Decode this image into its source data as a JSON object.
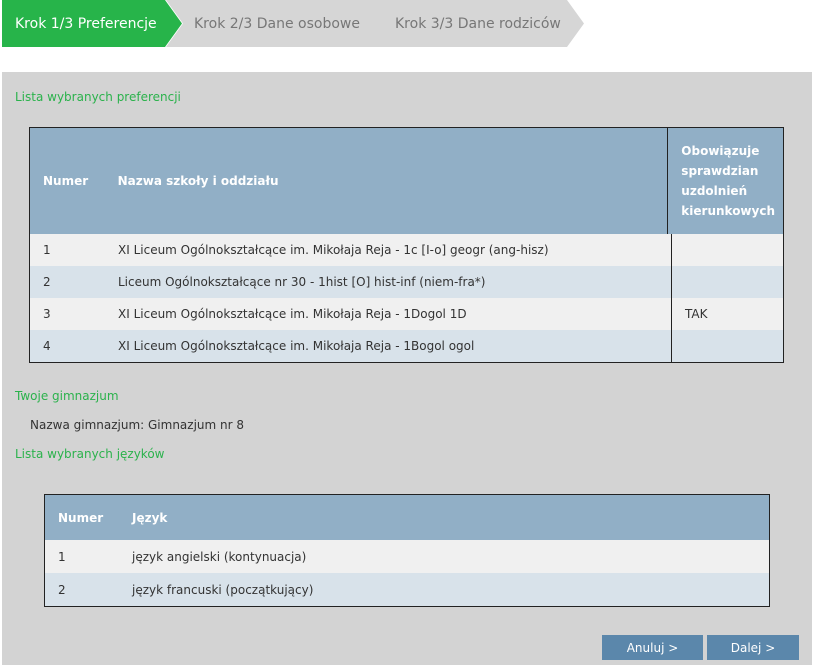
{
  "steps": [
    {
      "label": "Krok 1/3 Preferencje",
      "active": true
    },
    {
      "label": "Krok 2/3 Dane osobowe",
      "active": false
    },
    {
      "label": "Krok 3/3 Dane rodziców",
      "active": false
    }
  ],
  "colors": {
    "active_step": "#27b44a",
    "inactive_step": "#d6d6d6",
    "section_title": "#2bb24c",
    "table_header": "#91afc6",
    "button": "#5b87ab"
  },
  "preferences": {
    "title": "Lista wybranych preferencji",
    "headers": {
      "number": "Numer",
      "name": "Nazwa szkoły i oddziału",
      "exam": [
        "Obowiązuje",
        "sprawdzian",
        "uzdolnień",
        "kierunkowych"
      ]
    },
    "rows": [
      {
        "number": "1",
        "name": "XI Liceum Ogólnokształcące im. Mikołaja Reja - 1c [I-o] geogr (ang-hisz)",
        "exam": ""
      },
      {
        "number": "2",
        "name": "Liceum Ogólnokształcące nr 30 - 1hist [O] hist-inf (niem-fra*)",
        "exam": ""
      },
      {
        "number": "3",
        "name": "XI Liceum Ogólnokształcące im. Mikołaja Reja - 1Dogol 1D",
        "exam": "TAK"
      },
      {
        "number": "4",
        "name": "XI Liceum Ogólnokształcące im. Mikołaja Reja - 1Bogol ogol",
        "exam": ""
      }
    ]
  },
  "gymnasium": {
    "title": "Twoje gimnazjum",
    "line": "Nazwa gimnazjum: Gimnazjum nr 8"
  },
  "languages": {
    "title": "Lista wybranych języków",
    "headers": {
      "number": "Numer",
      "language": "Język"
    },
    "rows": [
      {
        "number": "1",
        "language": "język angielski (kontynuacja)"
      },
      {
        "number": "2",
        "language": "język francuski (początkujący)"
      }
    ]
  },
  "buttons": {
    "cancel": "Anuluj >",
    "next": "Dalej >"
  }
}
